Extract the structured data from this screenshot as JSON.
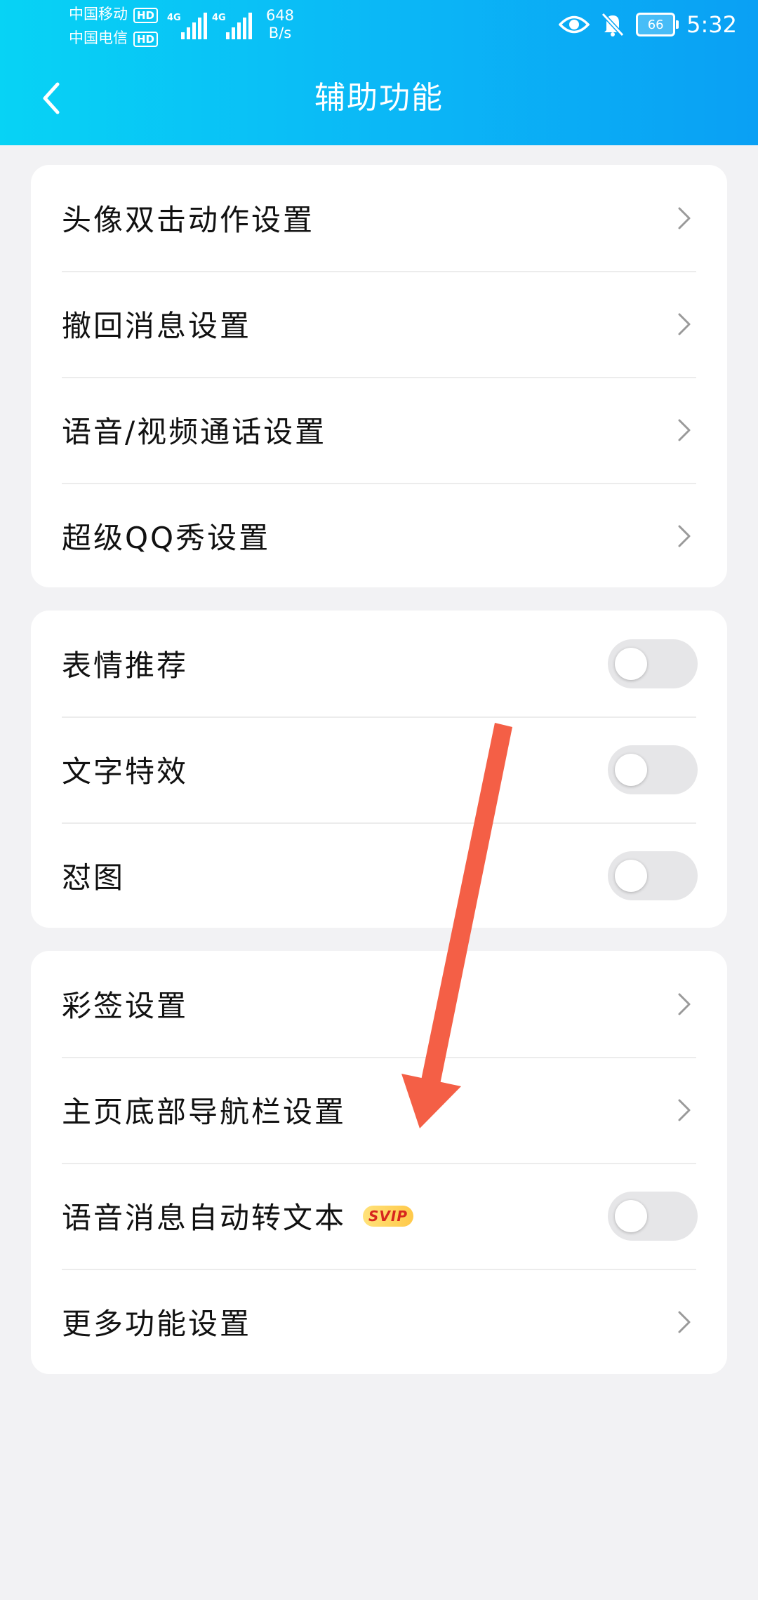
{
  "status_bar": {
    "carrier1": "中国移动",
    "carrier2": "中国电信",
    "hd_badge": "HD",
    "net_type1": "4G",
    "net_type2": "4G",
    "speed_value": "648",
    "speed_unit": "B/s",
    "battery": "66",
    "time": "5:32"
  },
  "header": {
    "title": "辅助功能"
  },
  "groups": [
    {
      "items": [
        {
          "label": "头像双击动作设置",
          "control": "chevron"
        },
        {
          "label": "撤回消息设置",
          "control": "chevron"
        },
        {
          "label": "语音/视频通话设置",
          "control": "chevron"
        },
        {
          "label": "超级QQ秀设置",
          "control": "chevron"
        }
      ]
    },
    {
      "items": [
        {
          "label": "表情推荐",
          "control": "toggle",
          "on": false
        },
        {
          "label": "文字特效",
          "control": "toggle",
          "on": false
        },
        {
          "label": "怼图",
          "control": "toggle",
          "on": false
        }
      ]
    },
    {
      "items": [
        {
          "label": "彩签设置",
          "control": "chevron"
        },
        {
          "label": "主页底部导航栏设置",
          "control": "chevron"
        },
        {
          "label": "语音消息自动转文本",
          "badge": "SVIP",
          "control": "toggle",
          "on": false
        },
        {
          "label": "更多功能设置",
          "control": "chevron"
        }
      ]
    }
  ],
  "colors": {
    "header_start": "#07d3f5",
    "header_end": "#0aa0f4",
    "annotation_arrow": "#f45f46",
    "toggle_off": "#e6e6e8",
    "chevron": "#9a9a9a"
  }
}
